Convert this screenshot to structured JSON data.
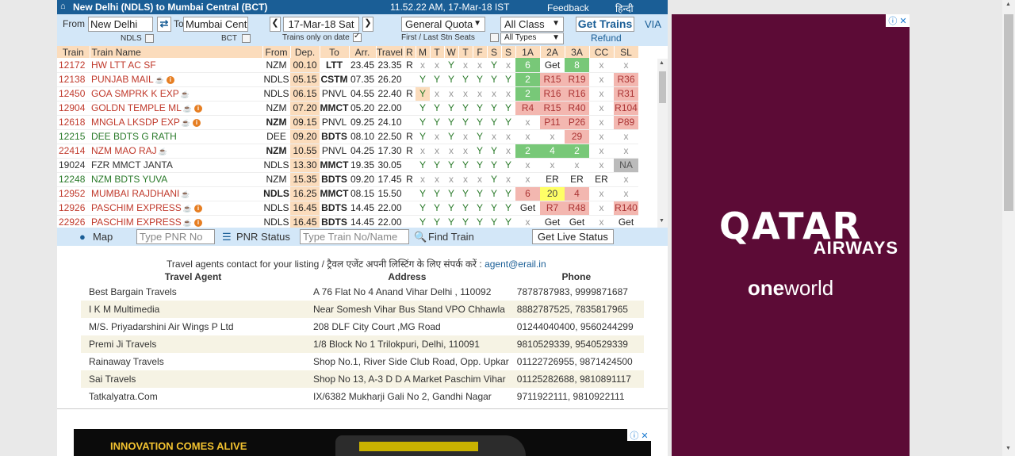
{
  "topbar": {
    "title": "New Delhi (NDLS) to Mumbai Central (BCT)",
    "time": "11.52.22 AM, 17-Mar-18 IST",
    "feedback": "Feedback",
    "hindi": "हिन्दी"
  },
  "form": {
    "from_label": "From",
    "from_value": "New Delhi",
    "to_label": "To",
    "to_value": "Mumbai Cent",
    "from_code": "NDLS",
    "to_code": "BCT",
    "date": "17-Mar-18 Sat",
    "trains_only_on_date": "Trains only on date",
    "quota": "General Quota",
    "first_last": "First / Last Stn Seats",
    "class": "All Class",
    "types": "All Types",
    "get_trains": "Get Trains",
    "via": "VIA",
    "refund": "Refund"
  },
  "table": {
    "headers": [
      "Train",
      "Train Name",
      "From",
      "Dep.",
      "To",
      "Arr.",
      "Travel",
      "R",
      "M",
      "T",
      "W",
      "T",
      "F",
      "S",
      "S",
      "1A",
      "2A",
      "3A",
      "CC",
      "SL"
    ],
    "rows": [
      {
        "no": "12172",
        "name": "HW LTT AC SF",
        "from": "NZM",
        "dep": "00.10",
        "to": "LTT",
        "arr": "23.45",
        "travel": "23.35",
        "r": "R",
        "days": [
          "x",
          "x",
          "Y",
          "x",
          "x",
          "Y",
          "x"
        ],
        "c": [
          "6",
          "Get",
          "8",
          "x",
          "x"
        ]
      },
      {
        "no": "12138",
        "name": "PUNJAB MAIL",
        "from": "NDLS",
        "dep": "05.15",
        "to": "CSTM",
        "arr": "07.35",
        "travel": "26.20",
        "r": "",
        "days": [
          "Y",
          "Y",
          "Y",
          "Y",
          "Y",
          "Y",
          "Y"
        ],
        "c": [
          "2",
          "R15",
          "R19",
          "x",
          "R36"
        ]
      },
      {
        "no": "12450",
        "name": "GOA SMPRK K EXP",
        "from": "NDLS",
        "dep": "06.15",
        "to": "PNVL",
        "arr": "04.55",
        "travel": "22.40",
        "r": "R",
        "days": [
          "Y",
          "x",
          "x",
          "x",
          "x",
          "x",
          "x"
        ],
        "c": [
          "2",
          "R16",
          "R16",
          "x",
          "R31"
        ]
      },
      {
        "no": "12904",
        "name": "GOLDN TEMPLE ML",
        "from": "NZM",
        "dep": "07.20",
        "to": "MMCT",
        "arr": "05.20",
        "travel": "22.00",
        "r": "",
        "days": [
          "Y",
          "Y",
          "Y",
          "Y",
          "Y",
          "Y",
          "Y"
        ],
        "c": [
          "R4",
          "R15",
          "R40",
          "x",
          "R104"
        ]
      },
      {
        "no": "12618",
        "name": "MNGLA LKSDP EXP",
        "from": "NZM",
        "dep": "09.15",
        "to": "PNVL",
        "arr": "09.25",
        "travel": "24.10",
        "r": "",
        "days": [
          "Y",
          "Y",
          "Y",
          "Y",
          "Y",
          "Y",
          "Y"
        ],
        "c": [
          "x",
          "P11",
          "P26",
          "x",
          "P89"
        ]
      },
      {
        "no": "12215",
        "name": "DEE BDTS G RATH",
        "from": "DEE",
        "dep": "09.20",
        "to": "BDTS",
        "arr": "08.10",
        "travel": "22.50",
        "r": "R",
        "days": [
          "Y",
          "x",
          "Y",
          "x",
          "Y",
          "x",
          "x"
        ],
        "c": [
          "x",
          "x",
          "29",
          "x",
          "x"
        ]
      },
      {
        "no": "22414",
        "name": "NZM MAO RAJ",
        "from": "NZM",
        "dep": "10.55",
        "to": "PNVL",
        "arr": "04.25",
        "travel": "17.30",
        "r": "R",
        "days": [
          "x",
          "x",
          "x",
          "x",
          "Y",
          "Y",
          "x"
        ],
        "c": [
          "2",
          "4",
          "2",
          "x",
          "x"
        ]
      },
      {
        "no": "19024",
        "name": "FZR MMCT JANTA",
        "from": "NDLS",
        "dep": "13.30",
        "to": "MMCT",
        "arr": "19.35",
        "travel": "30.05",
        "r": "",
        "days": [
          "Y",
          "Y",
          "Y",
          "Y",
          "Y",
          "Y",
          "Y"
        ],
        "c": [
          "x",
          "x",
          "x",
          "x",
          "NA"
        ]
      },
      {
        "no": "12248",
        "name": "NZM BDTS YUVA",
        "from": "NZM",
        "dep": "15.35",
        "to": "BDTS",
        "arr": "09.20",
        "travel": "17.45",
        "r": "R",
        "days": [
          "x",
          "x",
          "x",
          "x",
          "x",
          "Y",
          "x"
        ],
        "c": [
          "x",
          "ER",
          "ER",
          "ER",
          "x"
        ]
      },
      {
        "no": "12952",
        "name": "MUMBAI RAJDHANI",
        "from": "NDLS",
        "dep": "16.25",
        "to": "MMCT",
        "arr": "08.15",
        "travel": "15.50",
        "r": "",
        "days": [
          "Y",
          "Y",
          "Y",
          "Y",
          "Y",
          "Y",
          "Y"
        ],
        "c": [
          "6",
          "20",
          "4",
          "x",
          "x"
        ]
      },
      {
        "no": "12926",
        "name": "PASCHIM EXPRESS",
        "from": "NDLS",
        "dep": "16.45",
        "to": "BDTS",
        "arr": "14.45",
        "travel": "22.00",
        "r": "",
        "days": [
          "Y",
          "Y",
          "Y",
          "Y",
          "Y",
          "Y",
          "Y"
        ],
        "c": [
          "Get",
          "R7",
          "R48",
          "x",
          "R140"
        ]
      },
      {
        "no": "22926",
        "name": "PASCHIM EXPRESS",
        "from": "NDLS",
        "dep": "16.45",
        "to": "BDTS",
        "arr": "14.45",
        "travel": "22.00",
        "r": "",
        "days": [
          "Y",
          "Y",
          "Y",
          "Y",
          "Y",
          "Y",
          "Y"
        ],
        "c": [
          "x",
          "Get",
          "Get",
          "x",
          "Get"
        ]
      }
    ]
  },
  "bottombar": {
    "map": "Map",
    "pnr_placeholder": "Type PNR No",
    "pnr_status": "PNR Status",
    "train_placeholder": "Type Train No/Name",
    "find_train": "Find Train",
    "live_status": "Get Live Status"
  },
  "agents": {
    "heading": "Travel agents contact for your listing / ट्रैवल एजेंट अपनी लिस्टिंग के लिए संपर्क करें :",
    "email": "agent@erail.in",
    "col_agent": "Travel Agent",
    "col_address": "Address",
    "col_phone": "Phone",
    "rows": [
      {
        "name": "Best Bargain Travels",
        "address": "A 76 Flat No 4 Anand Vihar Delhi , 110092",
        "phone": "7878787983, 9999871687"
      },
      {
        "name": "I K M Multimedia",
        "address": "Near Somesh Vihar Bus Stand VPO Chhawla",
        "phone": "8882787525, 7835817965"
      },
      {
        "name": "M/S. Priyadarshini Air Wings P Ltd",
        "address": "208 DLF City Court ,MG Road",
        "phone": "01244040400, 9560244299"
      },
      {
        "name": "Premi Ji Travels",
        "address": "1/8 Block No 1 Trilokpuri, Delhi, 110091",
        "phone": "9810529339, 9540529339"
      },
      {
        "name": "Rainaway Travels",
        "address": "Shop No.1, River Side Club Road, Opp. Upkar",
        "phone": "01122726955, 9871424500"
      },
      {
        "name": "Sai Travels",
        "address": "Shop No 13, A-3 D D A Market Paschim Vihar",
        "phone": "01125282688, 9810891117"
      },
      {
        "name": "Tatkalyatra.Com",
        "address": "IX/6382 Mukharji Gali No 2, Gandhi Nagar",
        "phone": "9711922111, 9810922111"
      }
    ]
  },
  "ads": {
    "banner_text": "INNOVATION COMES ALIVE",
    "qatar": "QATAR",
    "airways": "AIRWAYS",
    "one": "one",
    "world": "world"
  }
}
